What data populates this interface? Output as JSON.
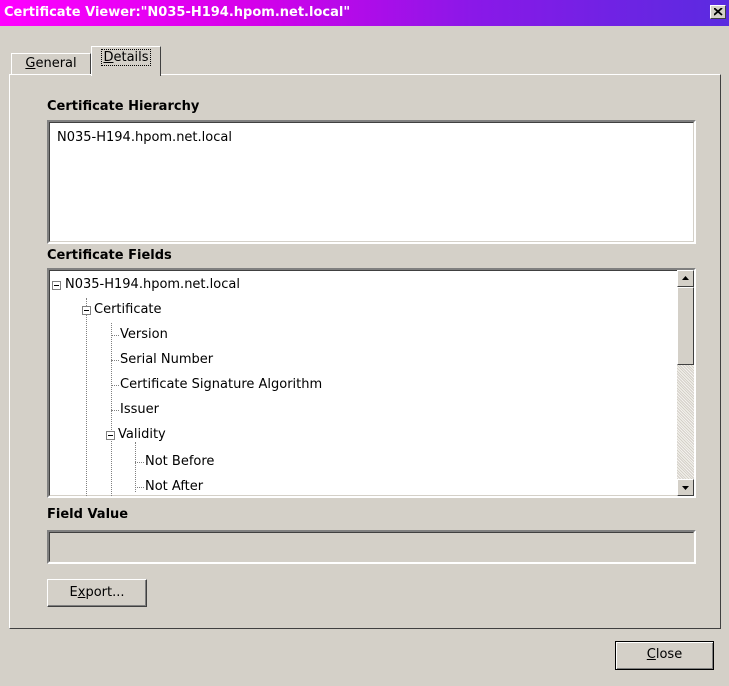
{
  "window": {
    "title": "Certificate Viewer:\"N035-H194.hpom.net.local\""
  },
  "tabs": [
    {
      "label_pre": "",
      "label_ul": "G",
      "label_post": "eneral"
    },
    {
      "label_pre": "",
      "label_ul": "D",
      "label_post": "etails"
    }
  ],
  "hierarchy": {
    "label": "Certificate Hierarchy",
    "items": [
      "N035-H194.hpom.net.local"
    ]
  },
  "fields": {
    "label": "Certificate Fields",
    "tree": [
      {
        "text": "N035-H194.hpom.net.local",
        "level": 0,
        "expander": "minus"
      },
      {
        "text": "Certificate",
        "level": 1,
        "expander": "minus"
      },
      {
        "text": "Version",
        "level": 2
      },
      {
        "text": "Serial Number",
        "level": 2
      },
      {
        "text": "Certificate Signature Algorithm",
        "level": 2
      },
      {
        "text": "Issuer",
        "level": 2
      },
      {
        "text": "Validity",
        "level": 2,
        "expander": "minus"
      },
      {
        "text": "Not Before",
        "level": 3
      },
      {
        "text": "Not After",
        "level": 3
      }
    ]
  },
  "field_value": {
    "label": "Field Value",
    "value": ""
  },
  "buttons": {
    "export": {
      "pre": "E",
      "ul": "x",
      "post": "port..."
    },
    "close": {
      "pre": "",
      "ul": "C",
      "post": "lose"
    }
  }
}
